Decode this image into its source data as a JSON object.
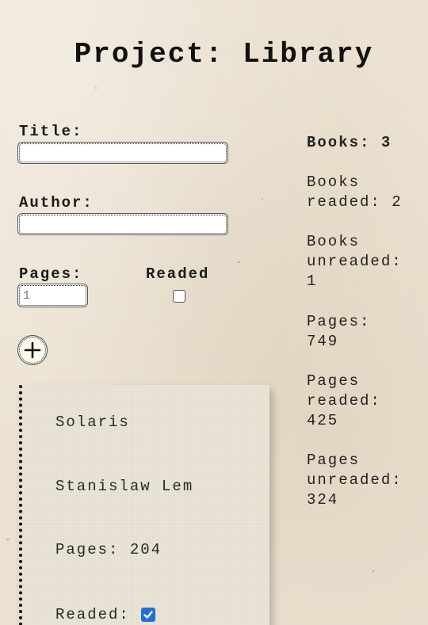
{
  "page_title": "Project: Library",
  "form": {
    "title_label": "Title:",
    "title_value": "",
    "author_label": "Author:",
    "author_value": "",
    "pages_label": "Pages:",
    "pages_placeholder": "1",
    "readed_label": "Readed",
    "readed_checked": false,
    "add_icon": "plus-circle-icon"
  },
  "stats": {
    "books": "Books: 3",
    "books_readed": "Books\nreaded: 2",
    "books_unreaded": "Books\nunreaded:\n1",
    "pages": "Pages:\n749",
    "pages_readed": "Pages\nreaded:\n425",
    "pages_unreaded": "Pages\nunreaded:\n324"
  },
  "books": [
    {
      "title": "Solaris",
      "author": "Stanislaw Lem",
      "pages": "Pages: 204",
      "readed_label": "Readed:",
      "readed": true
    }
  ],
  "colors": {
    "background": "#ece2d2",
    "checkbox_checked": "#1e6fd9"
  }
}
